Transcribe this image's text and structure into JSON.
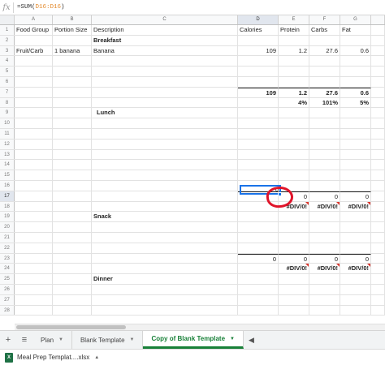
{
  "formula_bar": {
    "fx_label": "fx",
    "formula_prefix": "=SUM(",
    "formula_ref": "D16:D16",
    "formula_suffix": ")"
  },
  "columns": [
    "A",
    "B",
    "C",
    "D",
    "E",
    "F",
    "G"
  ],
  "rows": {
    "r1": {
      "num": "1",
      "A": "Food Group",
      "B": "Portion Size",
      "C": "Description",
      "D": "Calories",
      "E": "Protein",
      "F": "Carbs",
      "G": "Fat"
    },
    "r2": {
      "num": "2",
      "C": "Breakfast"
    },
    "r3": {
      "num": "3",
      "A": "Fruit/Carb",
      "B": "1 banana",
      "C": "Banana",
      "D": "109",
      "E": "1.2",
      "F": "27.6",
      "G": "0.6"
    },
    "r4": {
      "num": "4"
    },
    "r5": {
      "num": "5"
    },
    "r6": {
      "num": "6"
    },
    "r7": {
      "num": "7",
      "D": "109",
      "E": "1.2",
      "F": "27.6",
      "G": "0.6"
    },
    "r8": {
      "num": "8",
      "E": "4%",
      "F": "101%",
      "G": "5%"
    },
    "r9": {
      "num": "9",
      "C": "Lunch"
    },
    "r10": {
      "num": "10"
    },
    "r11": {
      "num": "11"
    },
    "r12": {
      "num": "12"
    },
    "r13": {
      "num": "13"
    },
    "r14": {
      "num": "14"
    },
    "r15": {
      "num": "15"
    },
    "r16": {
      "num": "16"
    },
    "r17": {
      "num": "17",
      "D": "0",
      "E": "0",
      "F": "0",
      "G": "0"
    },
    "r18": {
      "num": "18",
      "E": "#DIV/0!",
      "F": "#DIV/0!",
      "G": "#DIV/0!"
    },
    "r19": {
      "num": "19",
      "C": "Snack"
    },
    "r20": {
      "num": "20"
    },
    "r21": {
      "num": "21"
    },
    "r22": {
      "num": "22"
    },
    "r23": {
      "num": "23",
      "D": "0",
      "E": "0",
      "F": "0",
      "G": "0"
    },
    "r24": {
      "num": "24",
      "E": "#DIV/0!",
      "F": "#DIV/0!",
      "G": "#DIV/0!"
    },
    "r25": {
      "num": "25",
      "C": "Dinner"
    },
    "r26": {
      "num": "26"
    },
    "r27": {
      "num": "27"
    },
    "r28": {
      "num": "28"
    },
    "r29": {
      "num": "29"
    }
  },
  "tabs": {
    "add": "+",
    "menu": "≡",
    "plan": "Plan",
    "blank": "Blank Template",
    "copy": "Copy of Blank Template",
    "prev": "◀"
  },
  "download": {
    "filename": "Meal Prep Templat....xlsx",
    "icon_text": "X"
  },
  "colors": {
    "accent_green": "#188038",
    "selection_blue": "#1a73e8",
    "annotation_red": "#e0142a",
    "error_red": "#d9342b"
  }
}
